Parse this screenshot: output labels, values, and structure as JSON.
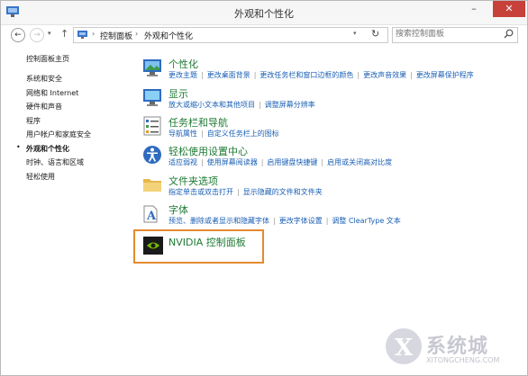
{
  "window": {
    "title": "外观和个性化",
    "close_glyph": "✕",
    "min_glyph": "–",
    "max_glyph": "□"
  },
  "nav": {
    "back_glyph": "←",
    "forward_glyph": "→",
    "dropdown_glyph": "▾",
    "up_glyph": "↑",
    "breadcrumb": [
      "控制面板",
      "外观和个性化"
    ],
    "breadcrumb_sep": "›",
    "address_dropdown_glyph": "▾",
    "refresh_glyph": "↻",
    "search_placeholder": "搜索控制面板"
  },
  "sidebar": {
    "items": [
      {
        "label": "控制面板主页",
        "active": false
      },
      {
        "label": "系统和安全",
        "active": false
      },
      {
        "label": "网络和 Internet",
        "active": false
      },
      {
        "label": "硬件和声音",
        "active": false
      },
      {
        "label": "程序",
        "active": false
      },
      {
        "label": "用户帐户和家庭安全",
        "active": false
      },
      {
        "label": "外观和个性化",
        "active": true
      },
      {
        "label": "时钟、语言和区域",
        "active": false
      },
      {
        "label": "轻松使用",
        "active": false
      }
    ],
    "active_bullet": "•"
  },
  "categories": [
    {
      "title": "个性化",
      "icon": "personalization-icon",
      "links": [
        "更改主题",
        "更改桌面背景",
        "更改任务栏和窗口边框的颜色",
        "更改声音效果",
        "更改屏幕保护程序"
      ]
    },
    {
      "title": "显示",
      "icon": "display-icon",
      "links": [
        "放大或缩小文本和其他项目",
        "调整屏幕分辨率"
      ]
    },
    {
      "title": "任务栏和导航",
      "icon": "taskbar-icon",
      "links": [
        "导航属性",
        "自定义任务栏上的图标"
      ]
    },
    {
      "title": "轻松使用设置中心",
      "icon": "ease-of-access-icon",
      "links": [
        "适应弱视",
        "使用屏幕阅读器",
        "启用键盘快捷键",
        "启用或关闭高对比度"
      ]
    },
    {
      "title": "文件夹选项",
      "icon": "folder-options-icon",
      "links": [
        "指定单击或双击打开",
        "显示隐藏的文件和文件夹"
      ]
    },
    {
      "title": "字体",
      "icon": "fonts-icon",
      "links": [
        "预览、删除或者显示和隐藏字体",
        "更改字体设置",
        "调整 ClearType 文本"
      ]
    }
  ],
  "nvidia": {
    "title": "NVIDIA 控制面板",
    "icon": "nvidia-icon"
  },
  "watermark": {
    "text": "系统城",
    "url": "XITONGCHENG.COM"
  },
  "colors": {
    "link": "#1a5fb4",
    "category_title": "#1e7a33",
    "highlight_border": "#e48a2f",
    "close_button": "#c7403a"
  }
}
